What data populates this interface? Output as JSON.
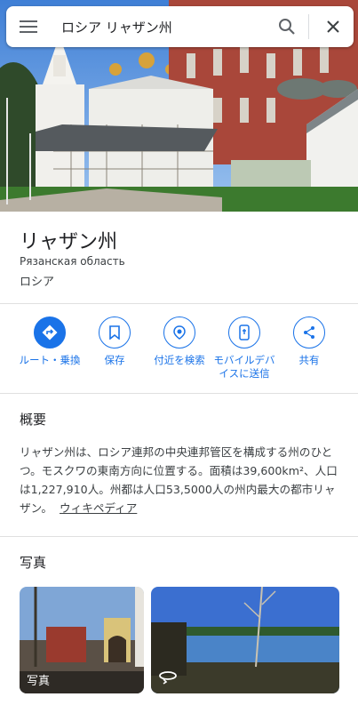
{
  "search": {
    "query": "ロシア リャザン州",
    "menu_icon": "menu-icon",
    "search_icon": "search-icon",
    "close_icon": "close-icon"
  },
  "place": {
    "title": "リャザン州",
    "native_name": "Рязанская область",
    "country": "ロシア"
  },
  "actions": [
    {
      "label": "ルート・乗換",
      "icon": "directions-icon"
    },
    {
      "label": "保存",
      "icon": "bookmark-icon"
    },
    {
      "label": "付近を検索",
      "icon": "nearby-icon"
    },
    {
      "label": "モバイルデバイスに送信",
      "icon": "send-to-phone-icon"
    },
    {
      "label": "共有",
      "icon": "share-icon"
    }
  ],
  "overview": {
    "heading": "概要",
    "text": "リャザン州は、ロシア連邦の中央連邦管区を構成する州のひとつ。モスクワの東南方向に位置する。面積は39,600km²、人口は1,227,910人。州都は人口53,5000人の州内最大の都市リャザン。",
    "link": "ウィキペディア"
  },
  "photos": {
    "heading": "写真",
    "first_label": "写真"
  },
  "colors": {
    "accent": "#1a73e8",
    "text_primary": "#202124",
    "text_secondary": "#3c4043",
    "divider": "#e0e0e0"
  }
}
